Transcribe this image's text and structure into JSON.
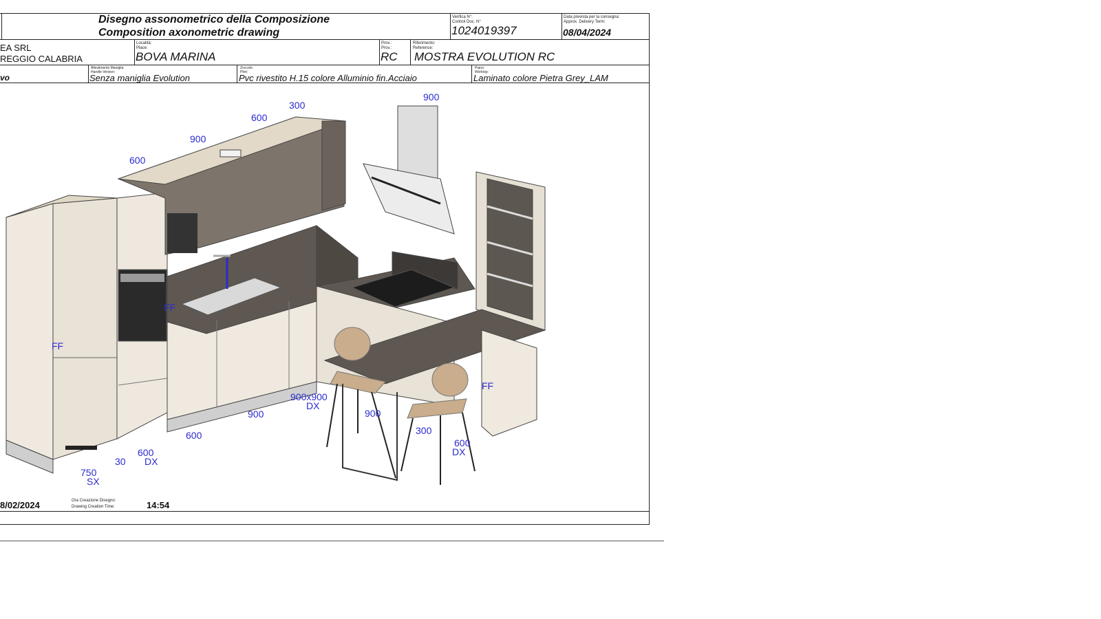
{
  "header": {
    "title_it": "Disegno assonometrico della Composizione",
    "title_en": "Composition axonometric drawing",
    "control_label_it": "Verifica N°:",
    "control_label_en": "Control Doc. N°",
    "control_number": "1024019397",
    "delivery_label_it": "Data prevista per la consegna:",
    "delivery_label_en": "Approx. Delivery Term:",
    "delivery_date": "08/04/2024"
  },
  "customer": {
    "name_partial": "EA SRL",
    "city_partial": "REGGIO CALABRIA",
    "place_label_it": "Località:",
    "place_label_en": "Place:",
    "place": "BOVA MARINA",
    "prov_label_it": "Prov.:",
    "prov_label_en": "Prov.:",
    "prov": "RC",
    "reference_label_it": "Riferimento:",
    "reference_label_en": "Reference:",
    "reference": "MOSTRA EVOLUTION RC"
  },
  "specs": {
    "first_partial": "vo",
    "handle_label_it": "Allestimento Maniglia:",
    "handle_label_en": "Handle Version:",
    "handle": "Senza maniglia Evolution",
    "plinth_label_it": "Zoccolo:",
    "plinth_label_en": "Plint:",
    "plinth": "Pvc rivestito H.15 colore Alluminio fin.Acciaio",
    "worktop_label_it": "Piano:",
    "worktop_label_en": "Worktop:",
    "worktop": "Laminato colore Pietra Grey_LAM"
  },
  "drawing": {
    "dimensions": [
      "300",
      "600",
      "900",
      "600",
      "900",
      "FF",
      "FF",
      "FF",
      "900x900",
      "DX",
      "900",
      "600",
      "600",
      "DX",
      "30",
      "750",
      "SX",
      "900",
      "300",
      "600",
      "DX"
    ]
  },
  "footer": {
    "date_partial": "8/02/2024",
    "time_label_it": "Ora Creazione Disegno:",
    "time_label_en": "Drawing Creation Time:",
    "time": "14:54"
  },
  "colors": {
    "dimension_text": "#2a2ad0",
    "cabinet": "#efe9df",
    "wall_unit": "#7d746b",
    "worktop": "#5f5852",
    "stool": "#c9ad8c"
  }
}
